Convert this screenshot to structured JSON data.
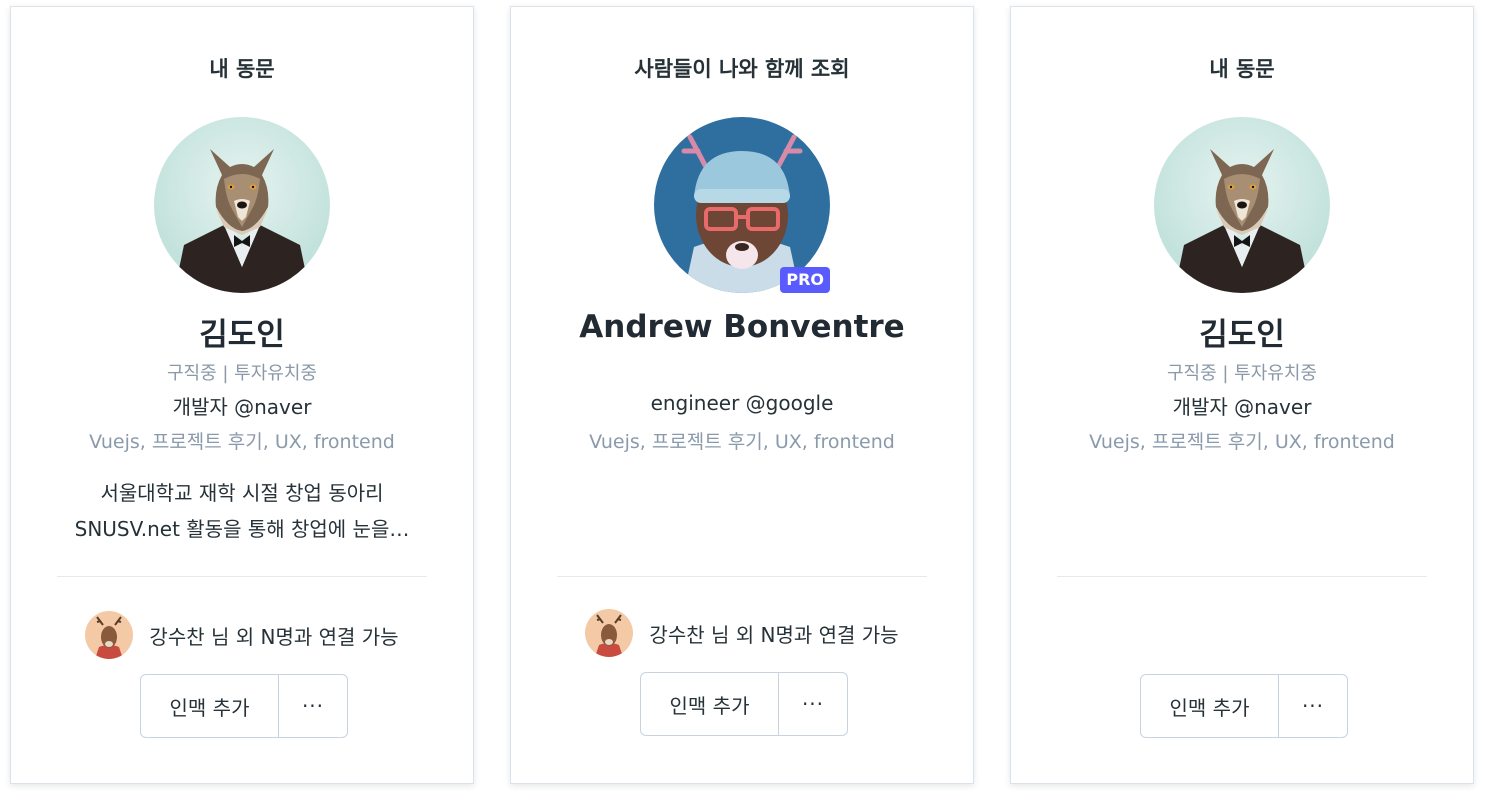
{
  "cards": [
    {
      "section_title": "내 동문",
      "name": "김도인",
      "status": "구직중 | 투자유치중",
      "job": "개발자 @naver",
      "tags": "Vuejs, 프로젝트 후기, UX, frontend",
      "bio_line1": "서울대학교 재학 시절 창업 동아리",
      "bio_line2": "SNUSV.net 활동을 통해 창업에 눈을…",
      "connection_text": "강수찬 님 외 N명과 연결 가능",
      "add_button": "인맥 추가",
      "more_button": "···",
      "avatar_icon": "wolf-avatar"
    },
    {
      "section_title": "사람들이 나와 함께 조회",
      "name": "Andrew Bonventre",
      "badge": "PRO",
      "job": "engineer @google",
      "tags": "Vuejs, 프로젝트 후기, UX, frontend",
      "connection_text": "강수찬 님 외 N명과 연결 가능",
      "add_button": "인맥 추가",
      "more_button": "···",
      "avatar_icon": "bear-avatar"
    },
    {
      "section_title": "내 동문",
      "name": "김도인",
      "status": "구직중 | 투자유치중",
      "job": "개발자 @naver",
      "tags": "Vuejs, 프로젝트 후기, UX, frontend",
      "add_button": "인맥 추가",
      "more_button": "···",
      "avatar_icon": "wolf-avatar"
    }
  ],
  "colors": {
    "pro_badge": "#5a5bff",
    "muted_text": "#8a98a8",
    "border": "#c8d3de"
  }
}
